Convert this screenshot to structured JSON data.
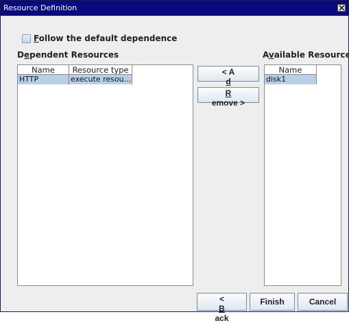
{
  "window": {
    "title": "Resource Definition",
    "close_label": "X"
  },
  "follow_default": {
    "checked": false,
    "label_first": "F",
    "label_rest": "ollow the default dependence"
  },
  "dependent": {
    "label_pre": "D",
    "label_mn": "e",
    "label_post": "pendent Resources",
    "columns": [
      "Name",
      "Resource type"
    ],
    "rows": [
      {
        "name": "HTTP",
        "type": "execute resou..."
      }
    ]
  },
  "available": {
    "label_pre": "A",
    "label_mn": "v",
    "label_post": "ailable Resources",
    "columns": [
      "Name"
    ],
    "rows": [
      {
        "name": "disk1"
      }
    ]
  },
  "buttons": {
    "add_pre": "< A",
    "add_mn": "d",
    "add_post": "d",
    "remove_mn": "R",
    "remove_post": "emove >",
    "back_pre": "< ",
    "back_mn": "B",
    "back_post": "ack",
    "finish": "Finish",
    "cancel": "Cancel"
  },
  "colors": {
    "titlebar": "#0a0a80",
    "selection": "#b8cfe5",
    "dialog_bg": "#eeeeee"
  }
}
